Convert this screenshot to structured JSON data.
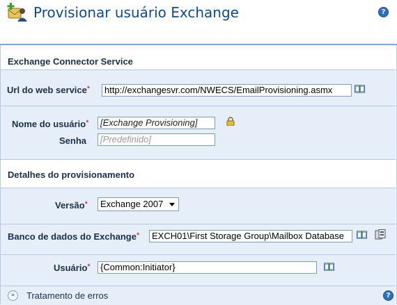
{
  "header": {
    "title": "Provisionar usuário Exchange",
    "help_icon": "help-icon"
  },
  "sections": {
    "connector_title": "Exchange Connector Service",
    "details_title": "Detalhes do provisionamento"
  },
  "fields": {
    "url": {
      "label": "Url do web service",
      "value": "http://exchangesvr.com/NWECS/EmailProvisioning.asmx"
    },
    "username": {
      "label": "Nome do usuário",
      "value": "[Exchange Provisioning]"
    },
    "password": {
      "label": "Senha",
      "placeholder": "[Predefinido]"
    },
    "version": {
      "label": "Versão",
      "selected": "Exchange 2007"
    },
    "database": {
      "label": "Banco de dados do Exchange",
      "value": "EXCH01\\First Storage Group\\Mailbox Database"
    },
    "user": {
      "label": "Usuário",
      "value": "{Common:Initiator}"
    }
  },
  "required_marker": "*",
  "footer": {
    "label": "Tratamento de erros"
  },
  "colors": {
    "title": "#0e4a8c",
    "band": "#e5eef9",
    "required": "#c00000"
  }
}
